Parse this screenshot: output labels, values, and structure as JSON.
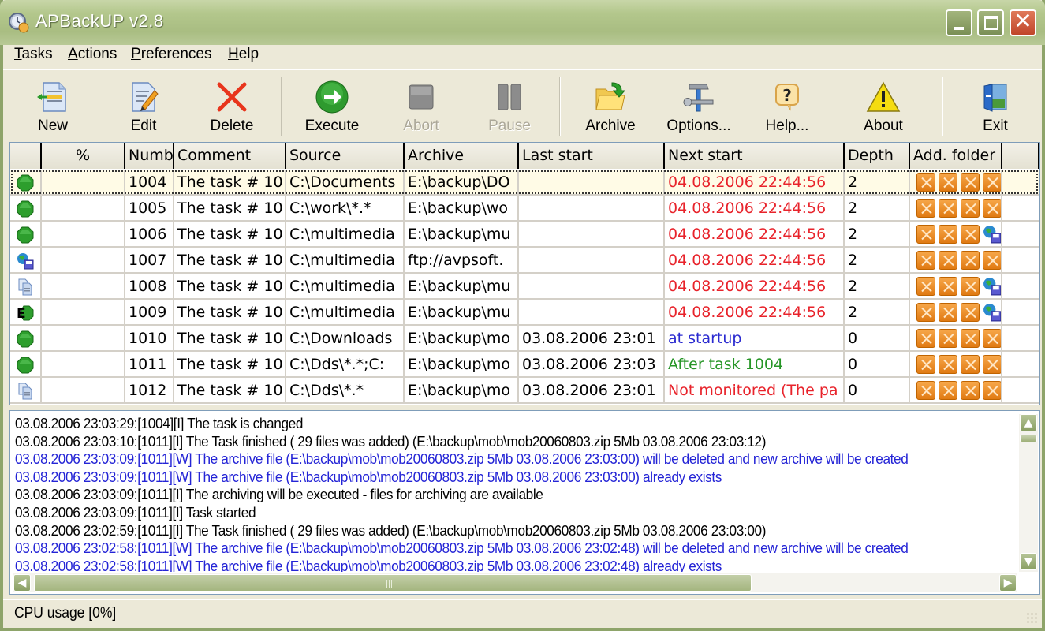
{
  "window": {
    "title": "APBackUP v2.8",
    "controls": {
      "minimize": "minimize",
      "maximize": "maximize",
      "close": "close"
    }
  },
  "menu": [
    {
      "label": "Tasks",
      "accel": "T"
    },
    {
      "label": "Actions",
      "accel": "A"
    },
    {
      "label": "Preferences",
      "accel": "P"
    },
    {
      "label": "Help",
      "accel": "H"
    }
  ],
  "toolbar": [
    {
      "id": "new",
      "label": "New",
      "icon": "new-document-icon",
      "enabled": true
    },
    {
      "id": "edit",
      "label": "Edit",
      "icon": "edit-document-icon",
      "enabled": true
    },
    {
      "id": "delete",
      "label": "Delete",
      "icon": "delete-x-icon",
      "enabled": true
    },
    {
      "id": "execute",
      "label": "Execute",
      "icon": "execute-arrow-icon",
      "enabled": true
    },
    {
      "id": "abort",
      "label": "Abort",
      "icon": "stop-icon",
      "enabled": false
    },
    {
      "id": "pause",
      "label": "Pause",
      "icon": "pause-icon",
      "enabled": false
    },
    {
      "id": "archive",
      "label": "Archive",
      "icon": "archive-folder-icon",
      "enabled": true
    },
    {
      "id": "options",
      "label": "Options...",
      "icon": "tools-icon",
      "enabled": true
    },
    {
      "id": "help",
      "label": "Help...",
      "icon": "help-bubble-icon",
      "enabled": true
    },
    {
      "id": "about",
      "label": "About",
      "icon": "warning-triangle-icon",
      "enabled": true
    },
    {
      "id": "exit",
      "label": "Exit",
      "icon": "exit-door-icon",
      "enabled": true
    }
  ],
  "grid": {
    "columns": [
      "",
      "%",
      "Numb",
      "Comment",
      "Source",
      "Archive",
      "Last start",
      "Next start",
      "Depth",
      "Add. folder",
      ""
    ],
    "rows": [
      {
        "status": "green",
        "percent": "",
        "number": "1004",
        "comment": "The task # 10",
        "source": "C:\\Documents",
        "archive": "E:\\backup\\DO",
        "last_start": "",
        "next_start": "04.08.2006 22:44:56",
        "next_color": "red",
        "depth": "2",
        "add_folder": [
          "x",
          "x",
          "x",
          "x"
        ],
        "selected": true
      },
      {
        "status": "green",
        "percent": "",
        "number": "1005",
        "comment": "The task # 10",
        "source": "C:\\work\\*.*",
        "archive": "E:\\backup\\wo",
        "last_start": "",
        "next_start": "04.08.2006 22:44:56",
        "next_color": "red",
        "depth": "2",
        "add_folder": [
          "x",
          "x",
          "x",
          "x"
        ]
      },
      {
        "status": "green",
        "percent": "",
        "number": "1006",
        "comment": "The task # 10",
        "source": "C:\\multimedia",
        "archive": "E:\\backup\\mu",
        "last_start": "",
        "next_start": "04.08.2006 22:44:56",
        "next_color": "red",
        "depth": "2",
        "add_folder": [
          "x",
          "x",
          "x",
          "ftp"
        ]
      },
      {
        "status": "ftp",
        "percent": "",
        "number": "1007",
        "comment": "The task # 10",
        "source": "C:\\multimedia",
        "archive": "ftp://avpsoft.",
        "last_start": "",
        "next_start": "04.08.2006 22:44:56",
        "next_color": "red",
        "depth": "2",
        "add_folder": [
          "x",
          "x",
          "x",
          "x"
        ]
      },
      {
        "status": "copy",
        "percent": "",
        "number": "1008",
        "comment": "The task # 10",
        "source": "C:\\multimedia",
        "archive": "E:\\backup\\mu",
        "last_start": "",
        "next_start": "04.08.2006 22:44:56",
        "next_color": "red",
        "depth": "2",
        "add_folder": [
          "x",
          "x",
          "x",
          "ftp"
        ]
      },
      {
        "status": "exec",
        "percent": "",
        "number": "1009",
        "comment": "The task # 10",
        "source": "C:\\multimedia",
        "archive": "E:\\backup\\mu",
        "last_start": "",
        "next_start": "04.08.2006 22:44:56",
        "next_color": "red",
        "depth": "2",
        "add_folder": [
          "x",
          "x",
          "x",
          "ftp"
        ]
      },
      {
        "status": "green",
        "percent": "",
        "number": "1010",
        "comment": "The task # 10",
        "source": "C:\\Downloads",
        "archive": "E:\\backup\\mo",
        "last_start": "03.08.2006 23:01",
        "next_start": "at startup",
        "next_color": "blue",
        "depth": "0",
        "add_folder": [
          "x",
          "x",
          "x",
          "x"
        ]
      },
      {
        "status": "green",
        "percent": "",
        "number": "1011",
        "comment": "The task # 10",
        "source": "C:\\Dds\\*.*;C:",
        "archive": "E:\\backup\\mo",
        "last_start": "03.08.2006 23:03",
        "next_start": "After task 1004",
        "next_color": "green",
        "depth": "0",
        "add_folder": [
          "x",
          "x",
          "x",
          "x"
        ]
      },
      {
        "status": "copy",
        "percent": "",
        "number": "1012",
        "comment": "The task # 10",
        "source": "C:\\Dds\\*.*",
        "archive": "E:\\backup\\mo",
        "last_start": "03.08.2006 23:01",
        "next_start": "Not monitored (The pa",
        "next_color": "red",
        "depth": "0",
        "add_folder": [
          "x",
          "x",
          "x",
          "x"
        ]
      }
    ]
  },
  "log": [
    {
      "type": "info",
      "text": "03.08.2006 23:03:29:[1004][I] The task is changed"
    },
    {
      "type": "info",
      "text": "03.08.2006 23:03:10:[1011][I] The Task finished ( 29 files was added) (E:\\backup\\mob\\mob20060803.zip 5Mb 03.08.2006 23:03:12)"
    },
    {
      "type": "warn",
      "text": "03.08.2006 23:03:09:[1011][W] The archive file (E:\\backup\\mob\\mob20060803.zip 5Mb 03.08.2006 23:03:00) will be deleted and new archive will be created"
    },
    {
      "type": "warn",
      "text": "03.08.2006 23:03:09:[1011][W] The archive file (E:\\backup\\mob\\mob20060803.zip 5Mb 03.08.2006 23:03:00) already exists"
    },
    {
      "type": "info",
      "text": "03.08.2006 23:03:09:[1011][I] The archiving will be executed - files for archiving are available"
    },
    {
      "type": "info",
      "text": "03.08.2006 23:03:09:[1011][I] Task started"
    },
    {
      "type": "info",
      "text": "03.08.2006 23:02:59:[1011][I] The Task finished ( 29 files was added) (E:\\backup\\mob\\mob20060803.zip 5Mb 03.08.2006 23:03:00)"
    },
    {
      "type": "warn",
      "text": "03.08.2006 23:02:58:[1011][W] The archive file (E:\\backup\\mob\\mob20060803.zip 5Mb 03.08.2006 23:02:48) will be deleted and new archive will be created"
    },
    {
      "type": "warn",
      "text": "03.08.2006 23:02:58:[1011][W] The archive file (E:\\backup\\mob\\mob20060803.zip 5Mb 03.08.2006 23:02:48) already exists"
    }
  ],
  "status_bar": {
    "text": "CPU usage [0%]"
  },
  "colors": {
    "title_bar": "#b3c78c",
    "next_red": "#e8232b",
    "next_blue": "#2a2ad0",
    "next_green": "#279627",
    "log_warn": "#2424d6",
    "add_folder_orange": "#f39a32"
  }
}
